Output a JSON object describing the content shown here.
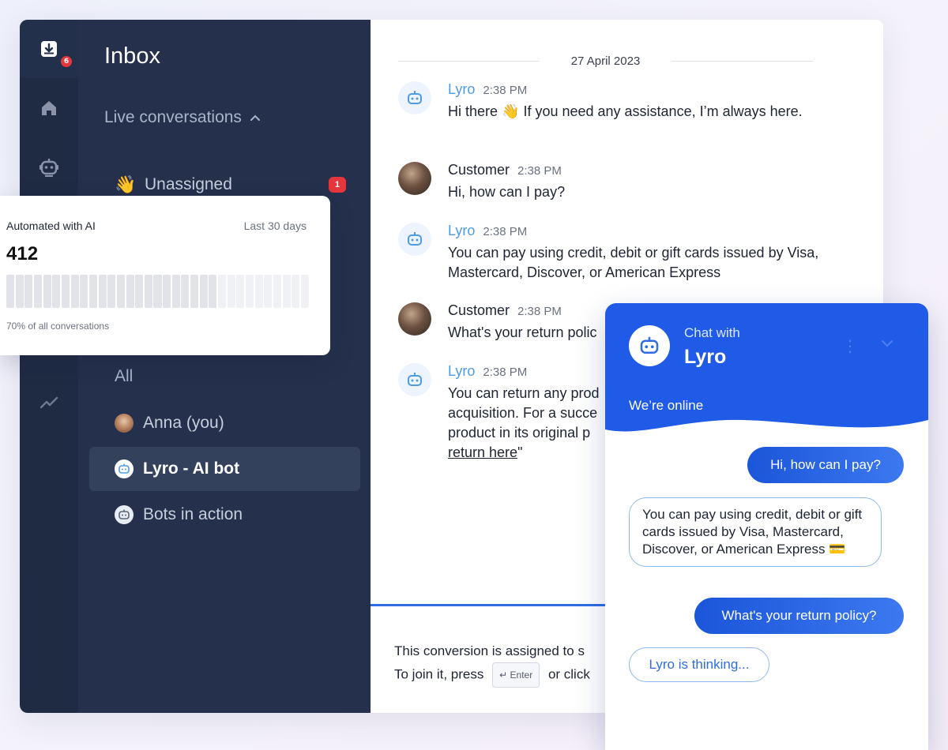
{
  "colors": {
    "accent": "#2f6ce5",
    "sidebar_bg": "#24304c",
    "rail_bg": "#1f2a43",
    "badge_red": "#e5363d",
    "bot_name_blue": "#4e9be6"
  },
  "rail": {
    "inbox_badge": "6",
    "icons": [
      "inbox-icon",
      "home-icon",
      "bot-icon",
      "trend-icon"
    ]
  },
  "sidebar": {
    "title": "Inbox",
    "section": "Live conversations",
    "unassigned": {
      "emoji": "👋",
      "label": "Unassigned",
      "badge": "1"
    },
    "all_label": "All",
    "items": [
      {
        "label": "Anna (you)"
      },
      {
        "label": "Lyro - AI bot",
        "active": true
      },
      {
        "label": "Bots in action"
      }
    ]
  },
  "stats": {
    "label": "Automated with AI",
    "range": "Last 30 days",
    "count": "412",
    "share_text": "70% of all conversations",
    "automated_fraction": 0.7
  },
  "chat": {
    "date": "27 April 2023",
    "messages": [
      {
        "sender": "Lyro",
        "time": "2:38 PM",
        "text": "Hi there 👋 If you need any assistance, I’m always here."
      },
      {
        "sender": "Customer",
        "time": "2:38 PM",
        "text": "Hi, how can I pay?"
      },
      {
        "sender": "Lyro",
        "time": "2:38 PM",
        "text": "You can pay using credit, debit or gift cards issued by Visa, Mastercard, Discover, or American Express"
      },
      {
        "sender": "Customer",
        "time": "2:38 PM",
        "text": "What's your return polic"
      },
      {
        "sender": "Lyro",
        "time": "2:38 PM",
        "text_lines": [
          "You can return any prod",
          "acquisition. For a succe",
          "product in its original p"
        ],
        "link": "return here",
        "link_suffix": "\""
      }
    ],
    "notice_line1": "This conversion is assigned to s",
    "notice_line2_prefix": "To join it, press",
    "enter_key": "↵ Enter",
    "notice_line2_suffix": "or click"
  },
  "widget": {
    "chat_with": "Chat with",
    "bot_name": "Lyro",
    "status": "We’re online",
    "messages": [
      {
        "from": "user",
        "text": "Hi, how can I pay?"
      },
      {
        "from": "bot",
        "text": "You can pay using credit, debit or gift cards issued by Visa, Mastercard, Discover, or American Express 💳"
      },
      {
        "from": "user",
        "text": "What's your return policy?"
      }
    ],
    "thinking": "Lyro is thinking..."
  }
}
